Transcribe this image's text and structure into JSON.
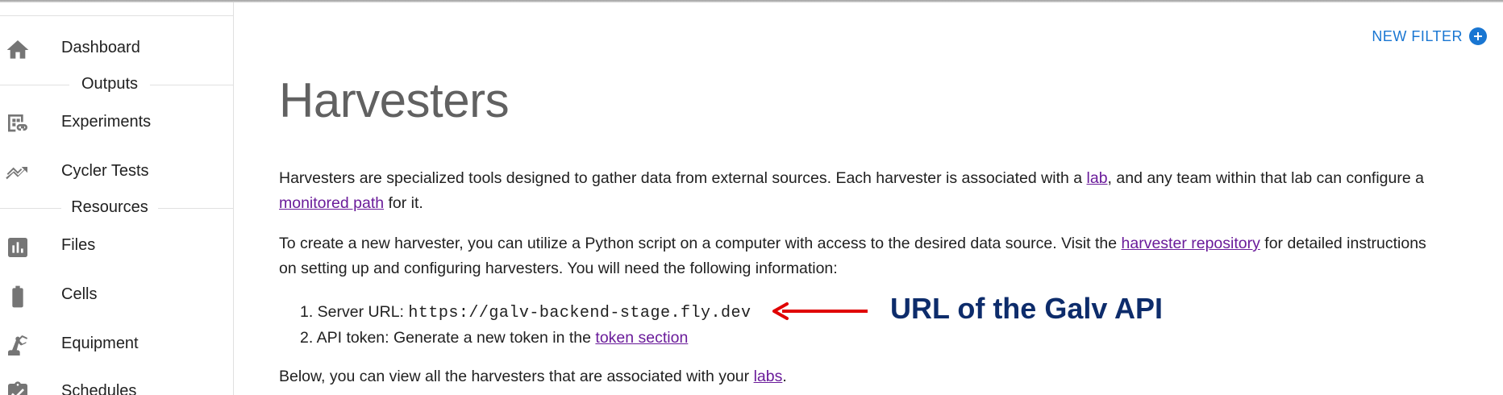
{
  "sidebar": {
    "items": [
      {
        "label": "Dashboard",
        "icon": "home-icon"
      },
      {
        "label": "Experiments",
        "icon": "experiments-icon"
      },
      {
        "label": "Cycler Tests",
        "icon": "cycler-tests-icon"
      },
      {
        "label": "Files",
        "icon": "files-chart-icon"
      },
      {
        "label": "Cells",
        "icon": "battery-icon"
      },
      {
        "label": "Equipment",
        "icon": "equipment-icon"
      },
      {
        "label": "Schedules",
        "icon": "clipboard-icon"
      }
    ],
    "sections": {
      "outputs": "Outputs",
      "resources": "Resources"
    }
  },
  "toolbar": {
    "new_filter_label": "NEW FILTER"
  },
  "main": {
    "title": "Harvesters",
    "p1": {
      "part1": "Harvesters are specialized tools designed to gather data from external sources. Each harvester is associated with a ",
      "link1": "lab",
      "part2": ", and any team within that lab can configure a ",
      "link2": "monitored path",
      "part3": " for it."
    },
    "p2": {
      "part1": "To create a new harvester, you can utilize a Python script on a computer with access to the desired data source. Visit the ",
      "link1": "harvester repository",
      "part2": " for detailed instructions on setting up and configuring harvesters. You will need the following information:"
    },
    "steps": {
      "step1_prefix": "1. Server URL: ",
      "step1_url": "https://galv-backend-stage.fly.dev",
      "step2_prefix": "2. API token: Generate a new token in the ",
      "step2_link": "token section"
    },
    "p3": {
      "part1": "Below, you can view all the harvesters that are associated with your ",
      "link1": "labs",
      "part2": "."
    }
  },
  "annotation": {
    "text": "URL of the Galv API",
    "arrow_color": "#e00000",
    "text_color": "#0d2c6b"
  },
  "colors": {
    "accent": "#1976d2",
    "link": "#6a1b9a",
    "icon": "#757575"
  }
}
